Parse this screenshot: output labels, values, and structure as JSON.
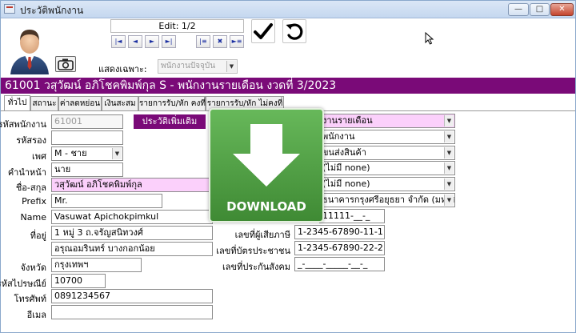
{
  "window": {
    "title": "ประวัติพนักงาน",
    "minimize_label": "—",
    "maximize_label": "□",
    "close_label": "✕"
  },
  "toolbar": {
    "edit_status": "Edit: 1/2",
    "nav_first": "|◄",
    "nav_prev": "◄",
    "nav_next": "►",
    "nav_last": "►|",
    "nav_mark": "|≡",
    "nav_clear": "✖",
    "nav_goto": "►≡",
    "save_icon": "check-icon",
    "undo_icon": "undo-icon"
  },
  "filter": {
    "label": "แสดงเฉพาะ:",
    "value": "พนักงานปัจจุบัน"
  },
  "banner": {
    "text": "61001 วสุวัฒน์ อภิโชคพิมพ์กุล  S - พนักงานรายเดือน  งวดที่ 3/2023"
  },
  "tabs": [
    {
      "label": "ทั่วไป"
    },
    {
      "label": "สถานะ"
    },
    {
      "label": "ค่าลดหย่อน"
    },
    {
      "label": "เงินสะสม"
    },
    {
      "label": "รายการรับ/หัก คงที่"
    },
    {
      "label": "รายการรับ/หัก ไม่คงที่"
    }
  ],
  "form": {
    "employee_code_label": "รหัสพนักงาน",
    "employee_code": "61001",
    "alt_code_label": "รหัสรอง",
    "alt_code": "",
    "gender_label": "เพศ",
    "gender": "M - ชาย",
    "title_label": "คำนำหน้า",
    "title": "นาย",
    "name_label": "ชื่อ-สกุล",
    "name": "วสุวัฒน์ อภิโชคพิมพ์กุล",
    "prefix_label": "Prefix",
    "prefix": "Mr.",
    "name_en_label": "Name",
    "name_en": "Vasuwat Apichokpimkul",
    "address_label": "ที่อยู่",
    "address1": "1 หมู่ 3 ถ.จรัญสนิทวงศ์",
    "address2": "อรุณอมรินทร์ บางกอกน้อย",
    "province_label": "จังหวัด",
    "province": "กรุงเทพฯ",
    "postcode_label": "รหัสไปรษณีย์",
    "postcode": "10700",
    "phone_label": "โทรศัพท์",
    "phone": "0891234567",
    "email_label": "อีเมล",
    "email": "",
    "more_history_button": "ประวัติเพิ่มเติม"
  },
  "right_column": {
    "employee_type": "งานรายเดือน",
    "position": "พนักงาน",
    "department": "ขนส่งสินค้า",
    "field4": "(ไม่มี none)",
    "field5": "(ไม่มี none)",
    "bank": "ธนาคารกรุงศรีอยุธยา จำกัด (มหาชน)",
    "bank_account": "11111-__-_",
    "taxpayer_id_label": "เลขที่ผู้เสียภาษี",
    "taxpayer_id": "1-2345-67890-11-1",
    "citizen_id_label": "เลขที่บัตรประชาชน",
    "citizen_id": "1-2345-67890-22-2",
    "social_security_label": "เลขที่ประกันสังคม",
    "social_security": "_-____-_____-__-_"
  },
  "overlay": {
    "label": "DOWNLOAD"
  }
}
